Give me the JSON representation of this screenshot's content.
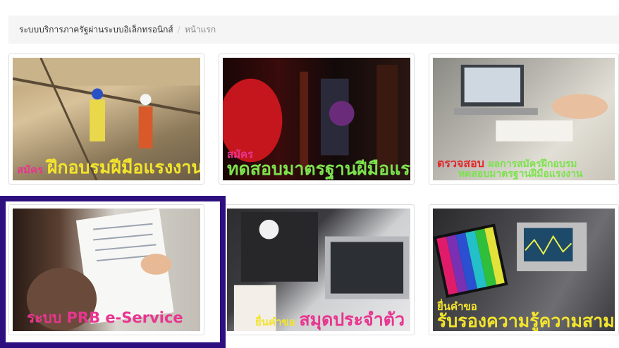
{
  "breadcrumb": {
    "root": "ระบบบริการภาครัฐผ่านระบบอิเล็กทรอนิกส์",
    "separator": "/",
    "current": "หน้าแรก"
  },
  "tiles": [
    {
      "label_a": "สมัคร",
      "label_b": "ฝึกอบรมฝีมือแรงงาน"
    },
    {
      "label_a": "สมัคร",
      "label_b": "ทดสอบมาตรฐานฝีมือแรงงาน"
    },
    {
      "label_a": "ตรวจสอบ",
      "label_b": "ผลการสมัครฝึกอบรม",
      "label_c": "ทดสอบมาตรฐานฝีมือแรงงาน"
    },
    {
      "label_a": "ระบบ PRB e-Service"
    },
    {
      "label_a": "ยื่นคำขอ",
      "label_b": "สมุดประจำตัว"
    },
    {
      "label_a": "ยื่นคำขอ",
      "label_b": "รับรองความรู้ความสามารถ"
    }
  ],
  "colors": {
    "selection_border": "#2d0f7f",
    "caption_pink": "#e8358f",
    "caption_yellow": "#f3e42d",
    "caption_green": "#7de24e",
    "caption_red": "#e3262b"
  }
}
